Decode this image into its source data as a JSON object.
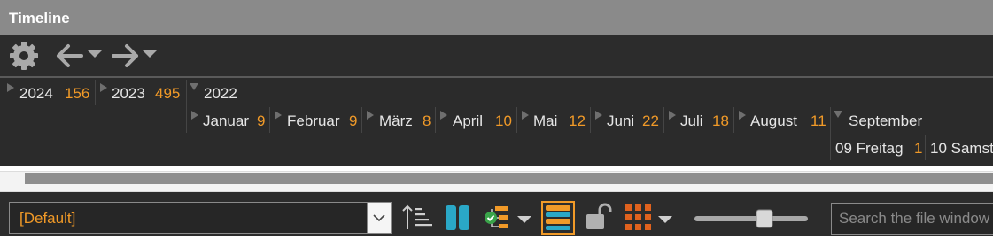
{
  "window": {
    "title": "Timeline"
  },
  "toolbar": {
    "icons": [
      "gear-icon",
      "back-arrow-icon",
      "forward-arrow-icon"
    ]
  },
  "years": [
    {
      "label": "2024",
      "count": "156"
    },
    {
      "label": "2023",
      "count": "495"
    },
    {
      "label": "2022",
      "count": ""
    }
  ],
  "months": [
    {
      "label": "Januar",
      "count": "9"
    },
    {
      "label": "Februar",
      "count": "9"
    },
    {
      "label": "März",
      "count": "8"
    },
    {
      "label": "April",
      "count": "10"
    },
    {
      "label": "Mai",
      "count": "12"
    },
    {
      "label": "Juni",
      "count": "22"
    },
    {
      "label": "Juli",
      "count": "18"
    },
    {
      "label": "August",
      "count": "11"
    },
    {
      "label": "September",
      "count": ""
    }
  ],
  "days": [
    {
      "label": "09 Freitag",
      "count": "1"
    },
    {
      "label": "10 Samst",
      "count": ""
    }
  ],
  "bottombar": {
    "preset_value": "[Default]",
    "search_placeholder": "Search the file window"
  },
  "colors": {
    "accent": "#f19a28",
    "teal": "#2aa8c7",
    "panel": "#2b2b2b"
  }
}
